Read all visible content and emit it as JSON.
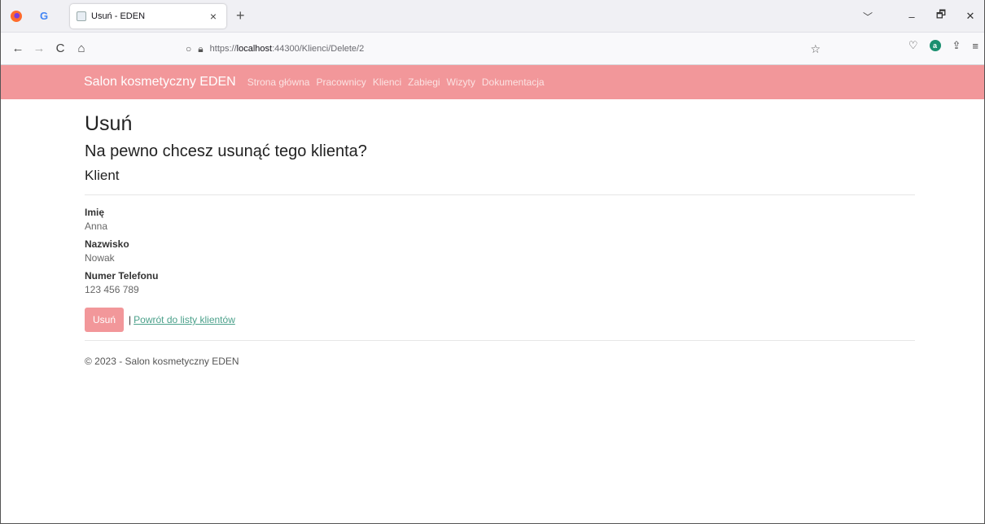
{
  "browser": {
    "tab_title": "Usuń - EDEN",
    "tab_close": "×",
    "new_tab": "+",
    "tab_list": "﹀",
    "url_scheme_host": "https://",
    "url_host": "localhost",
    "url_path": ":44300/Klienci/Delete/2",
    "window": {
      "minimize": "–",
      "restore": "🗗",
      "close": "✕"
    },
    "nav": {
      "back": "←",
      "forward": "→",
      "reload": "C",
      "home": "⌂"
    }
  },
  "site": {
    "brand": "Salon kosmetyczny EDEN",
    "nav_items": [
      "Strona główna",
      "Pracownicy",
      "Klienci",
      "Zabiegi",
      "Wizyty",
      "Dokumentacja"
    ]
  },
  "page": {
    "title": "Usuń",
    "question": "Na pewno chcesz usunąć tego klienta?",
    "entity": "Klient",
    "fields": [
      {
        "label": "Imię",
        "value": "Anna"
      },
      {
        "label": "Nazwisko",
        "value": "Nowak"
      },
      {
        "label": "Numer Telefonu",
        "value": "123 456 789"
      }
    ],
    "delete_button": "Usuń",
    "separator": "|",
    "back_link": "Powrót do listy klientów",
    "footer": "© 2023 - Salon kosmetyczny EDEN"
  },
  "colors": {
    "brand": "#f2979a",
    "link": "#4aa08a"
  }
}
